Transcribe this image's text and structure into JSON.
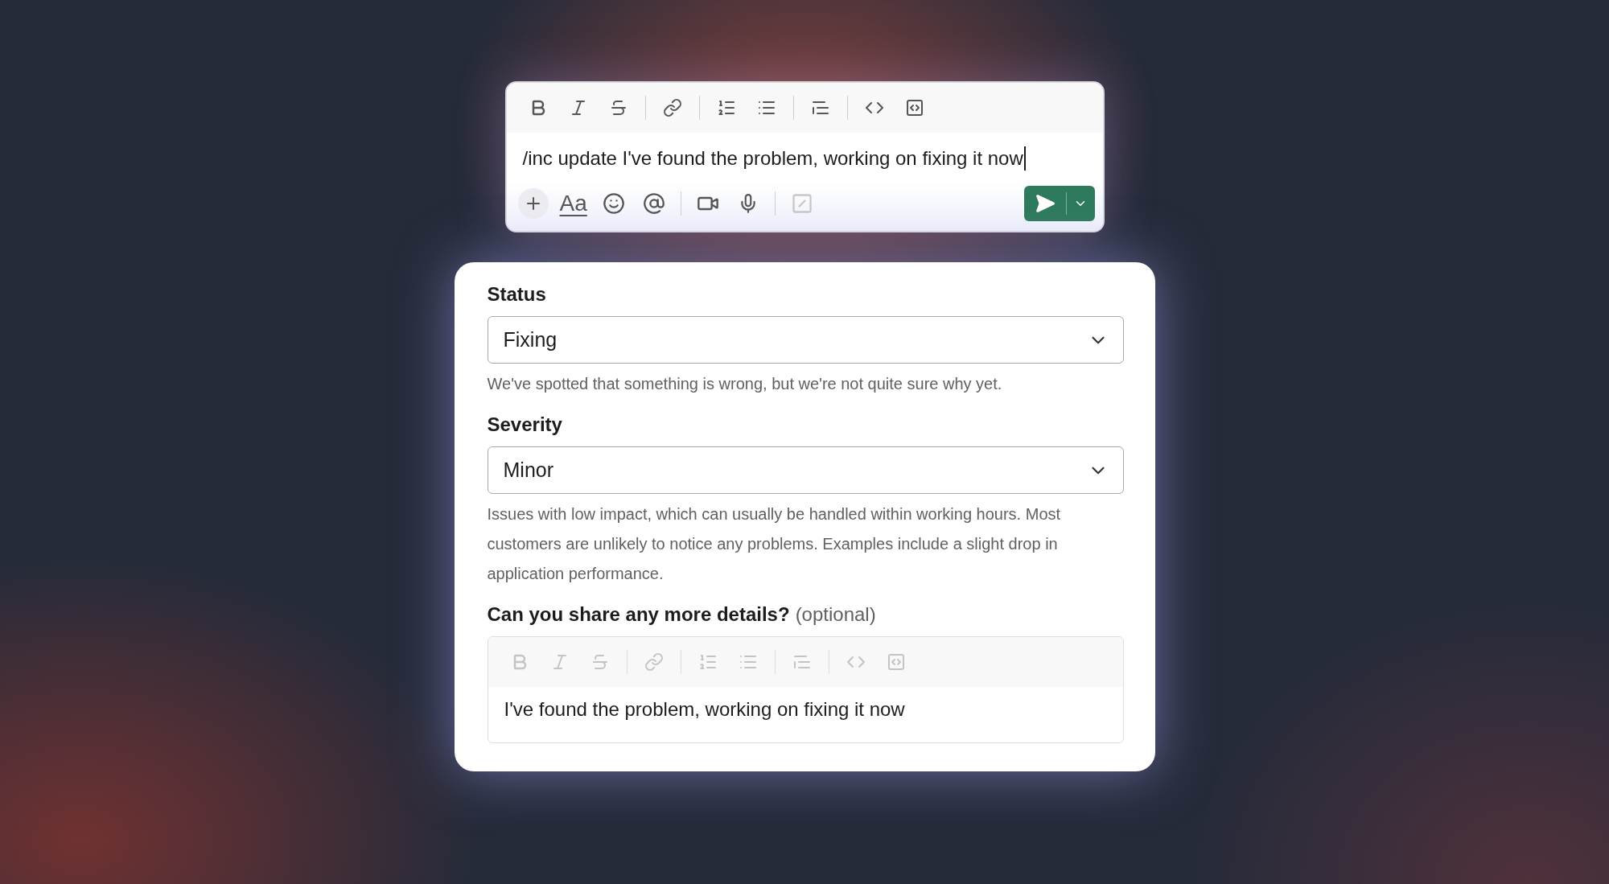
{
  "composer": {
    "message": "/inc update I've found the problem, working on fixing it now",
    "focused": true,
    "toolbar_disabled": false,
    "format_label": "Aa"
  },
  "form": {
    "fields": [
      {
        "kind": "select",
        "label": "Status",
        "value": "Fixing",
        "help": "We've spotted that something is wrong, but we're not quite sure why yet."
      },
      {
        "kind": "select",
        "label": "Severity",
        "value": "Minor",
        "help": "Issues with low impact, which can usually be handled within working hours. Most customers are unlikely to notice any problems. Examples include a slight drop in application performance."
      },
      {
        "kind": "editor",
        "label": "Can you share any more details?",
        "hint": "(optional)",
        "value": "I've found the problem, working on fixing it now",
        "toolbar_disabled": true
      }
    ]
  }
}
